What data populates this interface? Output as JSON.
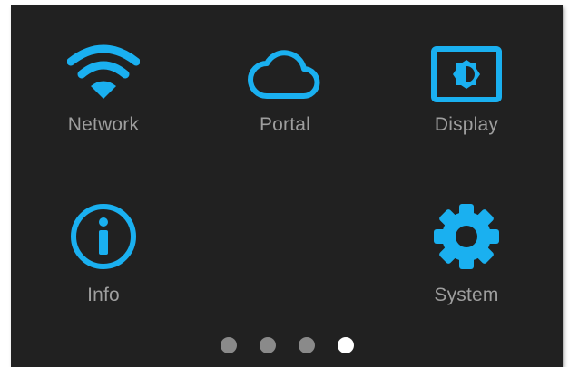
{
  "colors": {
    "background": "#212121",
    "accent": "#1ab0f0",
    "label": "#9e9e9e",
    "dot_inactive": "#8a8a8a",
    "dot_active": "#ffffff"
  },
  "menu": {
    "items": [
      {
        "label": "Network",
        "icon": "wifi-icon"
      },
      {
        "label": "Portal",
        "icon": "cloud-icon"
      },
      {
        "label": "Display",
        "icon": "display-brightness-icon"
      },
      {
        "label": "Info",
        "icon": "info-icon"
      },
      {
        "label": "System",
        "icon": "gear-icon"
      }
    ]
  },
  "pager": {
    "page_count": 4,
    "active_page": 4
  }
}
